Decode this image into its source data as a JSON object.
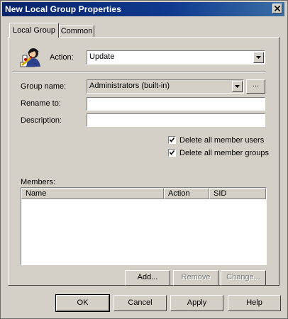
{
  "window": {
    "title": "New Local Group Properties"
  },
  "tabs": [
    {
      "label": "Local Group"
    },
    {
      "label": "Common"
    }
  ],
  "action": {
    "label": "Action:",
    "value": "Update"
  },
  "group_name": {
    "label": "Group name:",
    "value": "Administrators (built-in)",
    "browse_label": "..."
  },
  "rename_to": {
    "label": "Rename to:",
    "value": ""
  },
  "description": {
    "label": "Description:",
    "value": ""
  },
  "checkboxes": [
    {
      "label": "Delete all member users",
      "checked": true
    },
    {
      "label": "Delete all member groups",
      "checked": true
    }
  ],
  "members": {
    "label": "Members:",
    "columns": [
      "Name",
      "Action",
      "SID"
    ],
    "rows": []
  },
  "member_buttons": {
    "add": "Add...",
    "remove": "Remove",
    "change": "Change..."
  },
  "dialog_buttons": {
    "ok": "OK",
    "cancel": "Cancel",
    "apply": "Apply",
    "help": "Help"
  }
}
